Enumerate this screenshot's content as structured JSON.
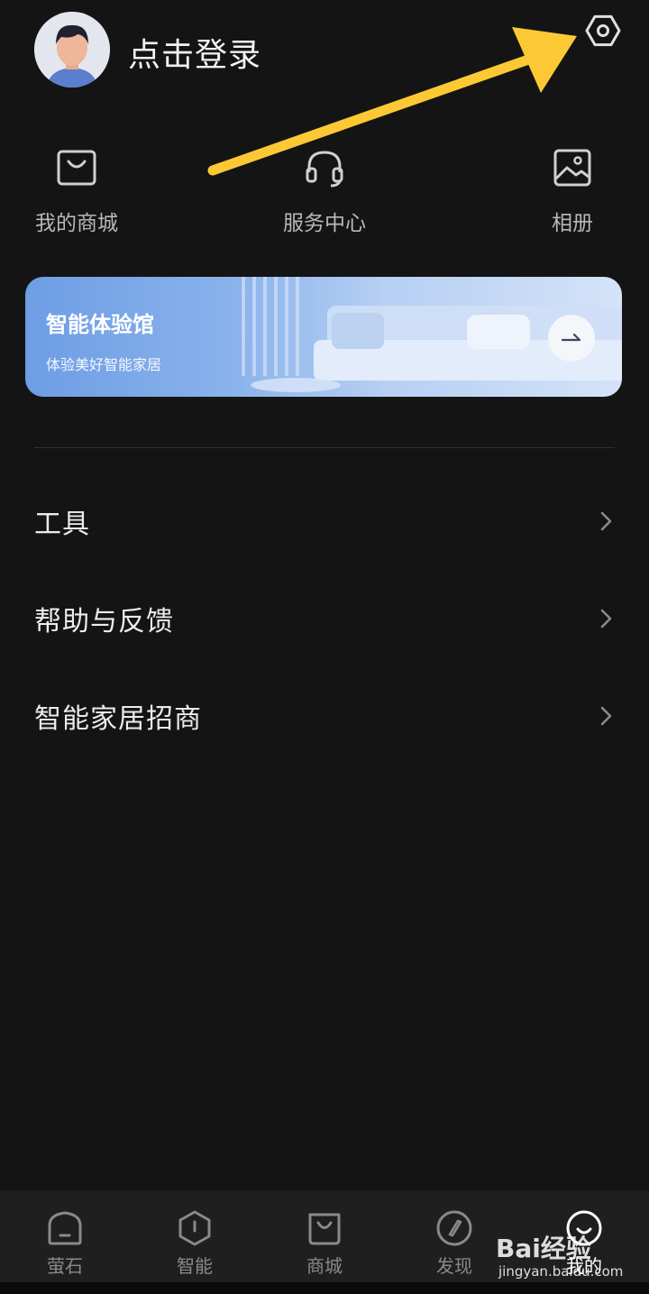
{
  "header": {
    "login_text": "点击登录"
  },
  "shortcuts": [
    {
      "label": "我的商城",
      "icon": "bag-icon"
    },
    {
      "label": "服务中心",
      "icon": "headset-icon"
    },
    {
      "label": "相册",
      "icon": "photo-icon"
    }
  ],
  "banner": {
    "title": "智能体验馆",
    "subtitle": "体验美好智能家居"
  },
  "menu": [
    {
      "label": "工具"
    },
    {
      "label": "帮助与反馈"
    },
    {
      "label": "智能家居招商"
    }
  ],
  "tabs": [
    {
      "label": "萤石",
      "icon": "home-icon"
    },
    {
      "label": "智能",
      "icon": "hexagon-info-icon"
    },
    {
      "label": "商城",
      "icon": "shopping-bag-icon"
    },
    {
      "label": "发现",
      "icon": "compass-icon"
    },
    {
      "label": "我的",
      "icon": "smile-icon",
      "active": true
    }
  ],
  "watermark": {
    "logo": "Bai经验",
    "url": "jingyan.baidu.com"
  },
  "colors": {
    "background": "#141414",
    "annotation_arrow": "#fcc934",
    "banner_start": "#6d9de4",
    "banner_end": "#d4e3f8"
  }
}
